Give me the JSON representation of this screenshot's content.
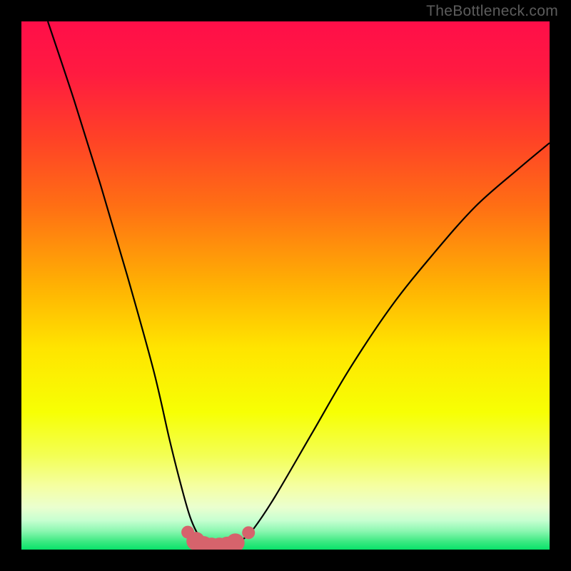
{
  "watermark": "TheBottleneck.com",
  "colors": {
    "gradient_stops": [
      {
        "offset": 0.0,
        "color": "#ff0e49"
      },
      {
        "offset": 0.1,
        "color": "#ff1b40"
      },
      {
        "offset": 0.22,
        "color": "#ff4127"
      },
      {
        "offset": 0.35,
        "color": "#ff6f14"
      },
      {
        "offset": 0.5,
        "color": "#ffb103"
      },
      {
        "offset": 0.62,
        "color": "#ffe500"
      },
      {
        "offset": 0.74,
        "color": "#f7ff04"
      },
      {
        "offset": 0.82,
        "color": "#f3ff52"
      },
      {
        "offset": 0.88,
        "color": "#f5ffa2"
      },
      {
        "offset": 0.92,
        "color": "#eaffcf"
      },
      {
        "offset": 0.945,
        "color": "#c6ffd0"
      },
      {
        "offset": 0.965,
        "color": "#8bf7b1"
      },
      {
        "offset": 0.985,
        "color": "#3be981"
      },
      {
        "offset": 1.0,
        "color": "#09e26a"
      }
    ],
    "curve_stroke": "#000000",
    "marker_fill": "#d6636c",
    "background": "#000000"
  },
  "chart_data": {
    "type": "line",
    "title": "",
    "xlabel": "",
    "ylabel": "",
    "xlim": [
      0,
      100
    ],
    "ylim": [
      0,
      100
    ],
    "series": [
      {
        "name": "bottleneck-curve",
        "x": [
          5,
          10,
          15,
          20,
          25,
          28,
          30,
          32,
          34,
          36,
          38,
          40,
          42,
          44,
          48,
          55,
          62,
          70,
          78,
          86,
          94,
          100
        ],
        "y": [
          100,
          85,
          69,
          52,
          34,
          21,
          13,
          6,
          2,
          0.5,
          0.5,
          0.8,
          2,
          4,
          10,
          22,
          34,
          46,
          56,
          65,
          72,
          77
        ]
      }
    ],
    "markers": {
      "name": "highlight-band",
      "x": [
        31.5,
        33.0,
        34.5,
        36.0,
        37.5,
        39.0,
        40.5,
        43.0
      ],
      "y": [
        3.3,
        1.6,
        0.8,
        0.5,
        0.5,
        0.7,
        1.3,
        3.2
      ],
      "size_first_last": 9,
      "size_mid": 13
    }
  }
}
